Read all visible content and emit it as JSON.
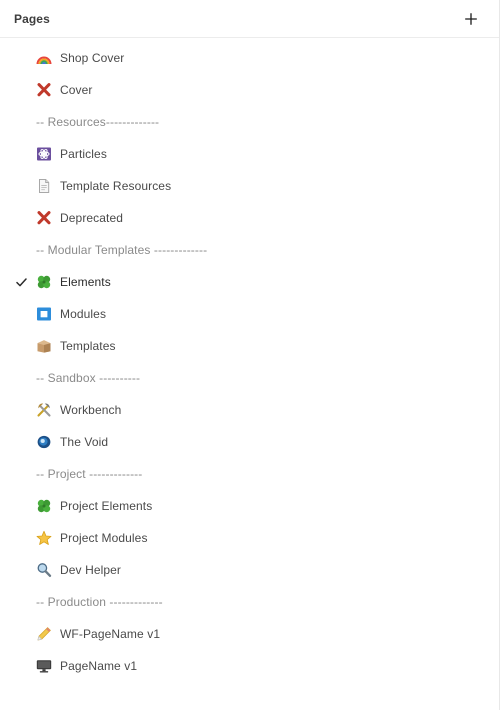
{
  "panel": {
    "title": "Pages",
    "add_button_label": "+",
    "add_button_icon": "plus-icon"
  },
  "pages": [
    {
      "label": "Shop Cover",
      "icon": "rainbow-icon",
      "type": "page",
      "selected": false
    },
    {
      "label": "Cover",
      "icon": "cross-mark-icon",
      "type": "page",
      "selected": false
    },
    {
      "label": "-- Resources-------------",
      "icon": "",
      "type": "divider",
      "selected": false
    },
    {
      "label": "Particles",
      "icon": "atom-symbol-icon",
      "type": "page",
      "selected": false
    },
    {
      "label": "Template Resources",
      "icon": "page-facing-up-icon",
      "type": "page",
      "selected": false
    },
    {
      "label": "Deprecated",
      "icon": "cross-mark-icon",
      "type": "page",
      "selected": false
    },
    {
      "label": "-- Modular Templates -------------",
      "icon": "",
      "type": "divider",
      "selected": false
    },
    {
      "label": "Elements",
      "icon": "four-leaf-clover-icon",
      "type": "page",
      "selected": true
    },
    {
      "label": "Modules",
      "icon": "blue-square-icon",
      "type": "page",
      "selected": false
    },
    {
      "label": "Templates",
      "icon": "package-icon",
      "type": "page",
      "selected": false
    },
    {
      "label": "-- Sandbox ----------",
      "icon": "",
      "type": "divider",
      "selected": false
    },
    {
      "label": "Workbench",
      "icon": "hammer-and-pick-icon",
      "type": "page",
      "selected": false
    },
    {
      "label": "The Void",
      "icon": "hole-icon",
      "type": "page",
      "selected": false
    },
    {
      "label": "-- Project -------------",
      "icon": "",
      "type": "divider",
      "selected": false
    },
    {
      "label": "Project Elements",
      "icon": "four-leaf-clover-icon",
      "type": "page",
      "selected": false
    },
    {
      "label": "Project Modules",
      "icon": "star-icon",
      "type": "page",
      "selected": false
    },
    {
      "label": "Dev Helper",
      "icon": "magnifying-glass-icon",
      "type": "page",
      "selected": false
    },
    {
      "label": "-- Production -------------",
      "icon": "",
      "type": "divider",
      "selected": false
    },
    {
      "label": "WF-PageName v1",
      "icon": "pencil-icon",
      "type": "page",
      "selected": false
    },
    {
      "label": "PageName v1",
      "icon": "desktop-computer-icon",
      "type": "page",
      "selected": false
    }
  ],
  "colors": {
    "background": "#ffffff",
    "text": "#4a4a4a",
    "divider_text": "#8a8a8a",
    "title": "#3d3d3d",
    "border": "#ececec"
  }
}
